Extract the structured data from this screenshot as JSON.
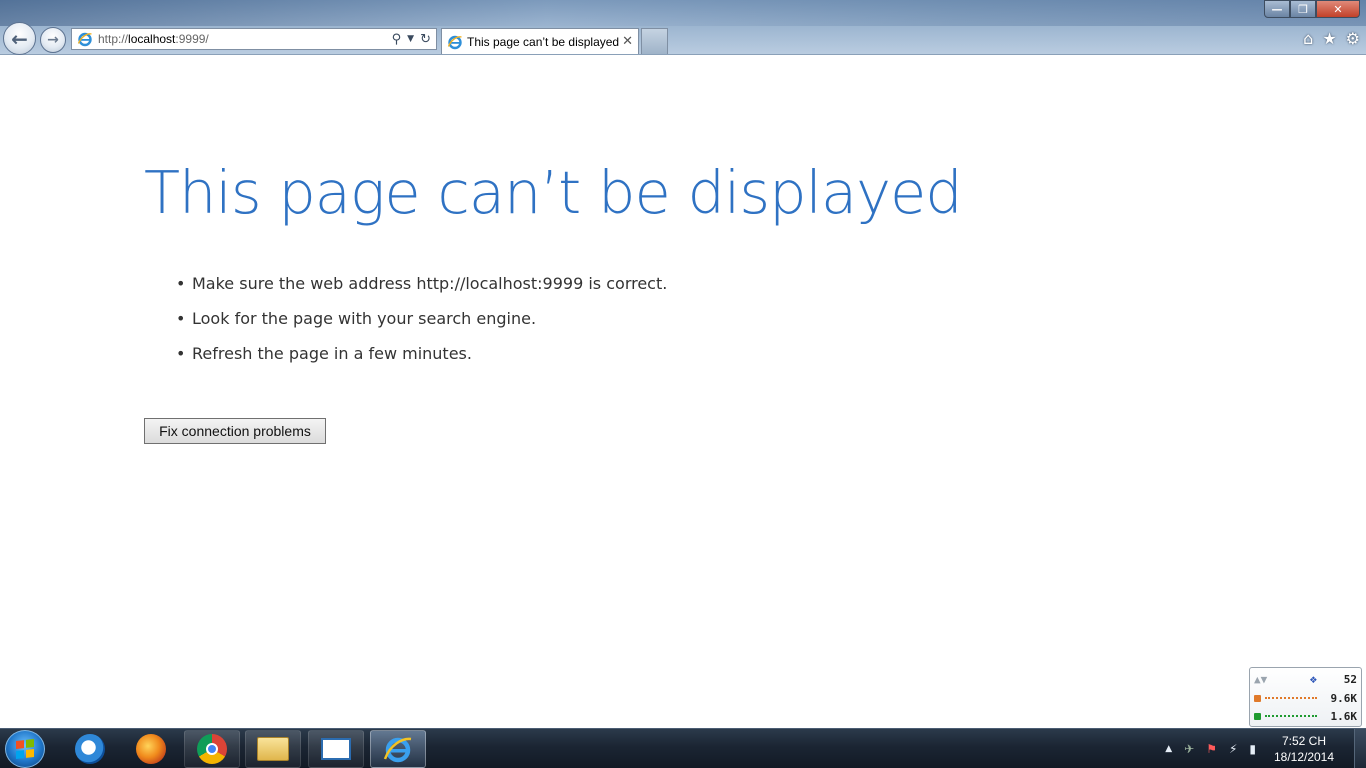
{
  "browser": {
    "address": {
      "scheme": "http://",
      "host": "localhost",
      "rest": ":9999/"
    },
    "tab_title": "This page can’t be displayed",
    "icons": {
      "back": "back-arrow-icon",
      "forward": "forward-arrow-icon",
      "search": "search-icon",
      "refresh": "refresh-icon",
      "home": "home-icon",
      "favorites": "star-icon",
      "tools": "gear-icon"
    }
  },
  "page": {
    "title": "This page can’t be displayed",
    "suggestions": [
      "Make sure the web address http://localhost:9999 is correct.",
      "Look for the page with your search engine.",
      "Refresh the page in a few minutes."
    ],
    "fix_button": "Fix connection problems"
  },
  "net_meter": {
    "count": "52",
    "upload": "9.6K",
    "download": "1.6K"
  },
  "taskbar": {
    "apps": [
      "CCleaner",
      "Firefox",
      "Chrome",
      "Windows Explorer",
      "Window app",
      "Internet Explorer"
    ],
    "time": "7:52 CH",
    "date": "18/12/2014"
  },
  "colors": {
    "title_blue": "#2f72c3",
    "taskbar": "#1b2533"
  }
}
